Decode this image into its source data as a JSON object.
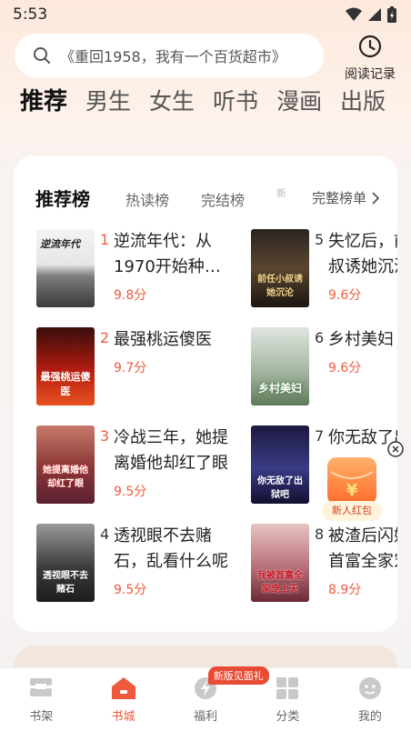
{
  "status": {
    "time": "5:53"
  },
  "search": {
    "placeholder": "《重回1958，我有一个百货超市》"
  },
  "history": {
    "label": "阅读记录"
  },
  "category_tabs": [
    "推荐",
    "男生",
    "女生",
    "听书",
    "漫画",
    "出版"
  ],
  "rank_tabs": [
    "推荐榜",
    "热读榜",
    "完结榜",
    "新"
  ],
  "full_rank_label": "完整榜单",
  "books": [
    {
      "rank": "1",
      "title": "逆流年代：从1970开始种田…",
      "score": "9.8分",
      "cover_text": "逆流年代"
    },
    {
      "rank": "2",
      "title": "最强桃运傻医",
      "score": "9.7分",
      "cover_text": "最强桃运傻医"
    },
    {
      "rank": "3",
      "title": "冷战三年，她提离婚他却红了眼",
      "score": "9.5分",
      "cover_text": "她提离婚他却红了眼"
    },
    {
      "rank": "4",
      "title": "透视眼不去赌石，乱看什么呢",
      "score": "9.5分",
      "cover_text": "透视眼不去赌石"
    },
    {
      "rank": "5",
      "title": "失忆后，前任小叔诱她沉沦",
      "score": "9.6分",
      "cover_text": "前任小叔诱她沉沦"
    },
    {
      "rank": "6",
      "title": "乡村美妇",
      "score": "9.6分",
      "cover_text": "乡村美妇"
    },
    {
      "rank": "7",
      "title": "你无敌了出狱吧",
      "score": "",
      "cover_text": "你无敌了出狱吧"
    },
    {
      "rank": "8",
      "title": "被渣后闪婚，被首富全家宠上天",
      "score": "8.9分",
      "cover_text": "我被首富全家宠上天"
    }
  ],
  "redpack": {
    "label": "新人红包"
  },
  "nav": [
    {
      "label": "书架",
      "icon": "bookshelf-icon"
    },
    {
      "label": "书城",
      "icon": "bookstore-icon"
    },
    {
      "label": "福利",
      "icon": "lightning-icon"
    },
    {
      "label": "分类",
      "icon": "category-icon"
    },
    {
      "label": "我的",
      "icon": "profile-icon"
    }
  ],
  "nav_badge": "新版见面礼",
  "colors": {
    "accent": "#ef5a3e",
    "badge": "#e94a34"
  }
}
